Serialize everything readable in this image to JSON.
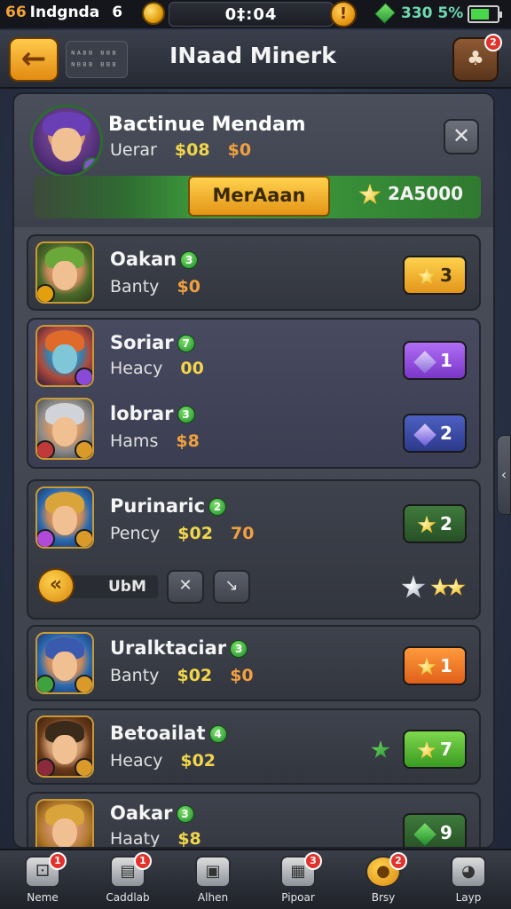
{
  "status_bar": {
    "tag": "66",
    "app_name": "Indgnda",
    "count": "6",
    "time": "0‡:04",
    "alert": "!",
    "battery_text": "330 5%"
  },
  "header": {
    "back_label": "←",
    "code": "ᴺᴬᴮᴮ ᴮᴮᴮ\nᴺᴮᴮᴮ ᴮᴮᴮ",
    "title": "INaad Minerk",
    "gift_badge": "2"
  },
  "hero": {
    "name": "Bactinue Mendam",
    "stat_label": "Uerar",
    "stat_value_1": "$08",
    "stat_value_2": "$0",
    "close_label": "✕",
    "cta_label": "MerAaan",
    "score": "2A5000"
  },
  "rows": [
    {
      "name": "Oakan",
      "level": "3",
      "stat_label": "Banty",
      "gold": "",
      "orange": "$0",
      "rank": "3",
      "rank_color": "yellow",
      "rank_icon": "star"
    },
    {
      "name": "Soriar",
      "level": "7",
      "stat_label": "Heacy",
      "gold": "",
      "orange": "00",
      "rank": "1",
      "rank_color": "purple",
      "rank_icon": "gem"
    },
    {
      "name": "lobrar",
      "level": "3",
      "stat_label": "Hams",
      "gold": "",
      "orange": "$8",
      "rank": "2",
      "rank_color": "blue",
      "rank_icon": "gem"
    },
    {
      "name": "Purinaric",
      "level": "2",
      "stat_label": "Pency",
      "gold": "$02",
      "orange": "70",
      "rank": "2",
      "rank_color": "green",
      "rank_icon": "star"
    },
    {
      "name": "Uralktaciar",
      "level": "3",
      "stat_label": "Banty",
      "gold": "$02",
      "orange": "$0",
      "rank": "1",
      "rank_color": "orange",
      "rank_icon": "star"
    },
    {
      "name": "Betoailat",
      "level": "4",
      "stat_label": "Heacy",
      "gold": "$02",
      "orange": "",
      "rank": "7",
      "rank_color": "lime",
      "rank_icon": "star"
    },
    {
      "name": "Oakar",
      "level": "3",
      "stat_label": "Haaty",
      "gold": "",
      "orange": "$8",
      "rank": "9",
      "rank_color": "green",
      "rank_icon": "gem"
    }
  ],
  "action_strip": {
    "knob_label": "«",
    "bar_label": "UbM",
    "tool1_label": "✕",
    "tool2_label": "↘"
  },
  "bottom_nav": [
    {
      "label": "Neme",
      "badge": "1",
      "icon": "dice-icon"
    },
    {
      "label": "Caddlab",
      "badge": "1",
      "icon": "card-icon"
    },
    {
      "label": "Alhen",
      "badge": "",
      "icon": "box-icon"
    },
    {
      "label": "Pipoar",
      "badge": "3",
      "icon": "chest-icon"
    },
    {
      "label": "Brsy",
      "badge": "2",
      "icon": "coin-icon"
    },
    {
      "label": "Layp",
      "badge": "",
      "icon": "ball-icon"
    }
  ]
}
